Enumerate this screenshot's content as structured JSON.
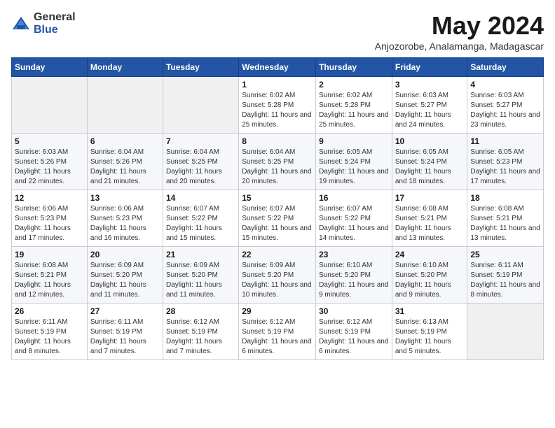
{
  "header": {
    "logo_general": "General",
    "logo_blue": "Blue",
    "month": "May 2024",
    "location": "Anjozorobe, Analamanga, Madagascar"
  },
  "calendar": {
    "days_of_week": [
      "Sunday",
      "Monday",
      "Tuesday",
      "Wednesday",
      "Thursday",
      "Friday",
      "Saturday"
    ],
    "weeks": [
      [
        {
          "day": "",
          "info": ""
        },
        {
          "day": "",
          "info": ""
        },
        {
          "day": "",
          "info": ""
        },
        {
          "day": "1",
          "info": "Sunrise: 6:02 AM\nSunset: 5:28 PM\nDaylight: 11 hours and 25 minutes."
        },
        {
          "day": "2",
          "info": "Sunrise: 6:02 AM\nSunset: 5:28 PM\nDaylight: 11 hours and 25 minutes."
        },
        {
          "day": "3",
          "info": "Sunrise: 6:03 AM\nSunset: 5:27 PM\nDaylight: 11 hours and 24 minutes."
        },
        {
          "day": "4",
          "info": "Sunrise: 6:03 AM\nSunset: 5:27 PM\nDaylight: 11 hours and 23 minutes."
        }
      ],
      [
        {
          "day": "5",
          "info": "Sunrise: 6:03 AM\nSunset: 5:26 PM\nDaylight: 11 hours and 22 minutes."
        },
        {
          "day": "6",
          "info": "Sunrise: 6:04 AM\nSunset: 5:26 PM\nDaylight: 11 hours and 21 minutes."
        },
        {
          "day": "7",
          "info": "Sunrise: 6:04 AM\nSunset: 5:25 PM\nDaylight: 11 hours and 20 minutes."
        },
        {
          "day": "8",
          "info": "Sunrise: 6:04 AM\nSunset: 5:25 PM\nDaylight: 11 hours and 20 minutes."
        },
        {
          "day": "9",
          "info": "Sunrise: 6:05 AM\nSunset: 5:24 PM\nDaylight: 11 hours and 19 minutes."
        },
        {
          "day": "10",
          "info": "Sunrise: 6:05 AM\nSunset: 5:24 PM\nDaylight: 11 hours and 18 minutes."
        },
        {
          "day": "11",
          "info": "Sunrise: 6:05 AM\nSunset: 5:23 PM\nDaylight: 11 hours and 17 minutes."
        }
      ],
      [
        {
          "day": "12",
          "info": "Sunrise: 6:06 AM\nSunset: 5:23 PM\nDaylight: 11 hours and 17 minutes."
        },
        {
          "day": "13",
          "info": "Sunrise: 6:06 AM\nSunset: 5:23 PM\nDaylight: 11 hours and 16 minutes."
        },
        {
          "day": "14",
          "info": "Sunrise: 6:07 AM\nSunset: 5:22 PM\nDaylight: 11 hours and 15 minutes."
        },
        {
          "day": "15",
          "info": "Sunrise: 6:07 AM\nSunset: 5:22 PM\nDaylight: 11 hours and 15 minutes."
        },
        {
          "day": "16",
          "info": "Sunrise: 6:07 AM\nSunset: 5:22 PM\nDaylight: 11 hours and 14 minutes."
        },
        {
          "day": "17",
          "info": "Sunrise: 6:08 AM\nSunset: 5:21 PM\nDaylight: 11 hours and 13 minutes."
        },
        {
          "day": "18",
          "info": "Sunrise: 6:08 AM\nSunset: 5:21 PM\nDaylight: 11 hours and 13 minutes."
        }
      ],
      [
        {
          "day": "19",
          "info": "Sunrise: 6:08 AM\nSunset: 5:21 PM\nDaylight: 11 hours and 12 minutes."
        },
        {
          "day": "20",
          "info": "Sunrise: 6:09 AM\nSunset: 5:20 PM\nDaylight: 11 hours and 11 minutes."
        },
        {
          "day": "21",
          "info": "Sunrise: 6:09 AM\nSunset: 5:20 PM\nDaylight: 11 hours and 11 minutes."
        },
        {
          "day": "22",
          "info": "Sunrise: 6:09 AM\nSunset: 5:20 PM\nDaylight: 11 hours and 10 minutes."
        },
        {
          "day": "23",
          "info": "Sunrise: 6:10 AM\nSunset: 5:20 PM\nDaylight: 11 hours and 9 minutes."
        },
        {
          "day": "24",
          "info": "Sunrise: 6:10 AM\nSunset: 5:20 PM\nDaylight: 11 hours and 9 minutes."
        },
        {
          "day": "25",
          "info": "Sunrise: 6:11 AM\nSunset: 5:19 PM\nDaylight: 11 hours and 8 minutes."
        }
      ],
      [
        {
          "day": "26",
          "info": "Sunrise: 6:11 AM\nSunset: 5:19 PM\nDaylight: 11 hours and 8 minutes."
        },
        {
          "day": "27",
          "info": "Sunrise: 6:11 AM\nSunset: 5:19 PM\nDaylight: 11 hours and 7 minutes."
        },
        {
          "day": "28",
          "info": "Sunrise: 6:12 AM\nSunset: 5:19 PM\nDaylight: 11 hours and 7 minutes."
        },
        {
          "day": "29",
          "info": "Sunrise: 6:12 AM\nSunset: 5:19 PM\nDaylight: 11 hours and 6 minutes."
        },
        {
          "day": "30",
          "info": "Sunrise: 6:12 AM\nSunset: 5:19 PM\nDaylight: 11 hours and 6 minutes."
        },
        {
          "day": "31",
          "info": "Sunrise: 6:13 AM\nSunset: 5:19 PM\nDaylight: 11 hours and 5 minutes."
        },
        {
          "day": "",
          "info": ""
        }
      ]
    ]
  }
}
